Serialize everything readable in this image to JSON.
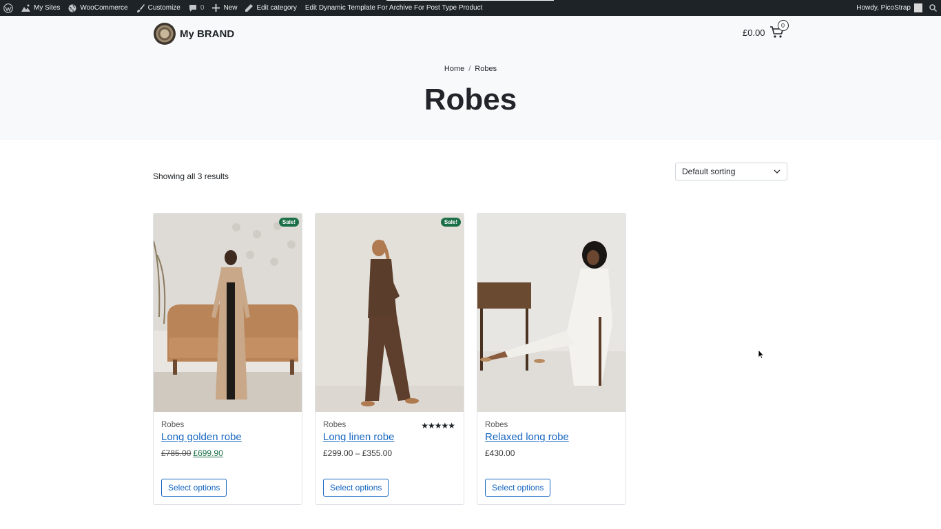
{
  "adminbar": {
    "my_sites": "My Sites",
    "woocommerce": "WooCommerce",
    "customize": "Customize",
    "comments_count": "0",
    "new": "New",
    "edit_category": "Edit category",
    "edit_template": "Edit Dynamic Template For Archive For Post Type Product",
    "howdy": "Howdy, PicoStrap"
  },
  "header": {
    "brand": "My BRAND",
    "cart_total": "£0.00",
    "cart_count": "0"
  },
  "breadcrumb": {
    "home": "Home",
    "separator": "/",
    "current": "Robes"
  },
  "page_title": "Robes",
  "results_text": "Showing all 3 results",
  "sorting": {
    "selected": "Default sorting"
  },
  "products": [
    {
      "category": "Robes",
      "title": "Long golden robe",
      "price_old": "£785.00",
      "price_new": "£699.90",
      "sale_badge": "Sale!",
      "button": "Select options"
    },
    {
      "category": "Robes",
      "title": "Long linen robe",
      "price_range": "£299.00 – £355.00",
      "sale_badge": "Sale!",
      "rating_stars": "★★★★★",
      "rating": 5,
      "button": "Select options"
    },
    {
      "category": "Robes",
      "title": "Relaxed long robe",
      "price": "£430.00",
      "button": "Select options"
    }
  ],
  "colors": {
    "adminbar_bg": "#1d2327",
    "hero_bg": "#f8f9fa",
    "link": "#1565c0",
    "sale_green": "#1a6f47"
  }
}
